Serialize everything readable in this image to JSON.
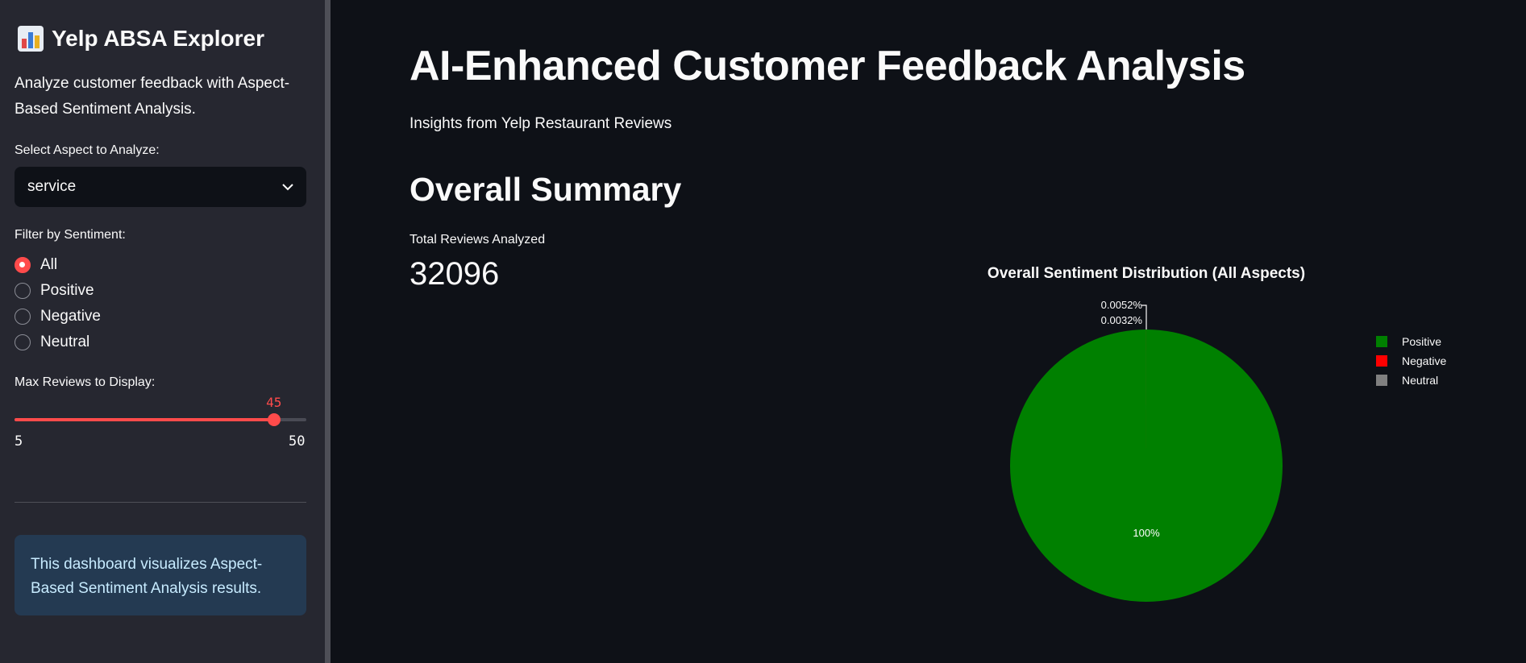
{
  "sidebar": {
    "title": "Yelp ABSA Explorer",
    "title_icon": "bar-chart-emoji-icon",
    "description": "Analyze customer feedback with Aspect-Based Sentiment Analysis.",
    "aspect_label": "Select Aspect to Analyze:",
    "aspect_value": "service",
    "sentiment_label": "Filter by Sentiment:",
    "sentiment_options": [
      "All",
      "Positive",
      "Negative",
      "Neutral"
    ],
    "sentiment_selected": "All",
    "max_reviews_label": "Max Reviews to Display:",
    "max_reviews": {
      "value": "45",
      "min": "5",
      "max": "50"
    },
    "info_text": "This dashboard visualizes Aspect-Based Sentiment Analysis results."
  },
  "main": {
    "title": "AI-Enhanced Customer Feedback Analysis",
    "subtitle": "Insights from Yelp Restaurant Reviews",
    "summary_heading": "Overall Summary",
    "metric_label": "Total Reviews Analyzed",
    "metric_value": "32096"
  },
  "colors": {
    "accent": "#ff4b4b",
    "positive": "#008000",
    "negative": "#ff0000",
    "neutral": "#808080",
    "info_bg": "#243a52"
  },
  "chart_data": {
    "type": "pie",
    "title": "Overall Sentiment Distribution (All Aspects)",
    "labels": [
      "Positive",
      "Negative",
      "Neutral"
    ],
    "values": [
      99.9916,
      0.0052,
      0.0032
    ],
    "slice_labels": [
      "100%",
      "0.0052%",
      "0.0032%"
    ],
    "colors": [
      "#008000",
      "#ff0000",
      "#808080"
    ],
    "legend_position": "right"
  }
}
